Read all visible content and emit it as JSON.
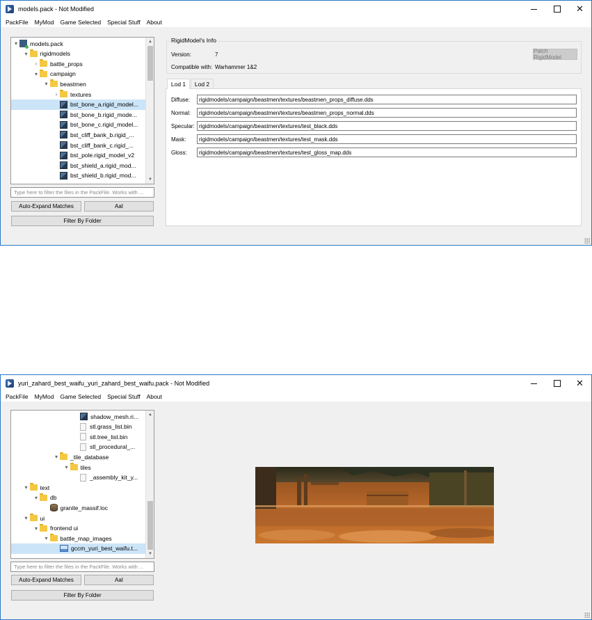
{
  "menu": [
    "PackFile",
    "MyMod",
    "Game Selected",
    "Special Stuff",
    "About"
  ],
  "window1": {
    "title": "models.pack - Not Modified",
    "tree": [
      {
        "label": "models.pack",
        "icon": "pack-icon",
        "arrow": "▾",
        "indent": 0
      },
      {
        "label": "rigidmodels",
        "icon": "folder-icon",
        "arrow": "▾",
        "indent": 1
      },
      {
        "label": "battle_props",
        "icon": "folder-icon",
        "arrow": "›",
        "indent": 2
      },
      {
        "label": "campaign",
        "icon": "folder-icon",
        "arrow": "▾",
        "indent": 2
      },
      {
        "label": "beastmen",
        "icon": "folder-icon",
        "arrow": "▾",
        "indent": 3
      },
      {
        "label": "textures",
        "icon": "folder-icon",
        "arrow": "›",
        "indent": 4
      },
      {
        "label": "bst_bone_a.rigid_model...",
        "icon": "model-icon",
        "arrow": "",
        "indent": 4,
        "selected": true
      },
      {
        "label": "bst_bone_b.rigid_mode...",
        "icon": "model-icon",
        "arrow": "",
        "indent": 4
      },
      {
        "label": "bst_bone_c.rigid_model...",
        "icon": "model-icon",
        "arrow": "",
        "indent": 4
      },
      {
        "label": "bst_cliff_bank_b.rigid_...",
        "icon": "model-icon",
        "arrow": "",
        "indent": 4
      },
      {
        "label": "bst_cliff_bank_c.rigid_...",
        "icon": "model-icon",
        "arrow": "",
        "indent": 4
      },
      {
        "label": "bst_pole.rigid_model_v2",
        "icon": "model-icon",
        "arrow": "",
        "indent": 4
      },
      {
        "label": "bst_shield_a.rigid_mod...",
        "icon": "model-icon",
        "arrow": "",
        "indent": 4
      },
      {
        "label": "bst_shield_b.rigid_mod...",
        "icon": "model-icon",
        "arrow": "",
        "indent": 4
      }
    ],
    "filter_placeholder": "Type here to filter the files in the PackFile. Works with ...",
    "auto_expand_label": "Auto-Expand Matches",
    "case_label": "AaI",
    "filter_folder_label": "Filter By Folder",
    "info": {
      "group_title": "RigidModel's Info",
      "version_label": "Version:",
      "version_value": "7",
      "compatible_label": "Compatible with:",
      "compatible_value": "Warhammer 1&2",
      "patch_label": "Patch RigidModel"
    },
    "tabs": [
      "Lod 1",
      "Lod 2"
    ],
    "fields": [
      {
        "label": "Diffuse:",
        "value": "rigidmodels/campaign/beastmen/textures/beastmen_props_diffuse.dds"
      },
      {
        "label": "Normal:",
        "value": "rigidmodels/campaign/beastmen/textures/beastmen_props_normal.dds"
      },
      {
        "label": "Specular:",
        "value": "rigidmodels/campaign/beastmen/textures/test_black.dds"
      },
      {
        "label": "Mask:",
        "value": "rigidmodels/campaign/beastmen/textures/test_mask.dds"
      },
      {
        "label": "Gloss:",
        "value": "rigidmodels/campaign/beastmen/textures/test_gloss_map.dds"
      }
    ]
  },
  "window2": {
    "title": "yuri_zahard_best_waifu_yuri_zahard_best_waifu.pack - Not Modified",
    "tree": [
      {
        "label": "shadow_mesh.ri...",
        "icon": "model-icon",
        "arrow": "",
        "indent": 6
      },
      {
        "label": "stl.grass_list.bin",
        "icon": "file-icon",
        "arrow": "",
        "indent": 6
      },
      {
        "label": "stl.tree_list.bin",
        "icon": "file-icon",
        "arrow": "",
        "indent": 6
      },
      {
        "label": "stl_procedural_...",
        "icon": "file-icon",
        "arrow": "",
        "indent": 6
      },
      {
        "label": "_tile_database",
        "icon": "folder-icon",
        "arrow": "▾",
        "indent": 4
      },
      {
        "label": "tiles",
        "icon": "folder-icon",
        "arrow": "▾",
        "indent": 5
      },
      {
        "label": "_assembly_kit_y...",
        "icon": "file-icon",
        "arrow": "",
        "indent": 6
      },
      {
        "label": "text",
        "icon": "folder-icon",
        "arrow": "▾",
        "indent": 1
      },
      {
        "label": "db",
        "icon": "folder-icon",
        "arrow": "▾",
        "indent": 2
      },
      {
        "label": "granite_massif.loc",
        "icon": "db-icon",
        "arrow": "",
        "indent": 3
      },
      {
        "label": "ui",
        "icon": "folder-icon",
        "arrow": "▾",
        "indent": 1
      },
      {
        "label": "frontend ui",
        "icon": "folder-icon",
        "arrow": "▾",
        "indent": 2
      },
      {
        "label": "battle_map_images",
        "icon": "folder-icon",
        "arrow": "▾",
        "indent": 3
      },
      {
        "label": "gccm_yuri_best_waifu.t...",
        "icon": "image-icon",
        "arrow": "",
        "indent": 4,
        "selected": true
      }
    ],
    "filter_placeholder": "Type here to filter the files in the PackFile. Works with ...",
    "auto_expand_label": "Auto-Expand Matches",
    "case_label": "AaI",
    "filter_folder_label": "Filter By Folder"
  }
}
